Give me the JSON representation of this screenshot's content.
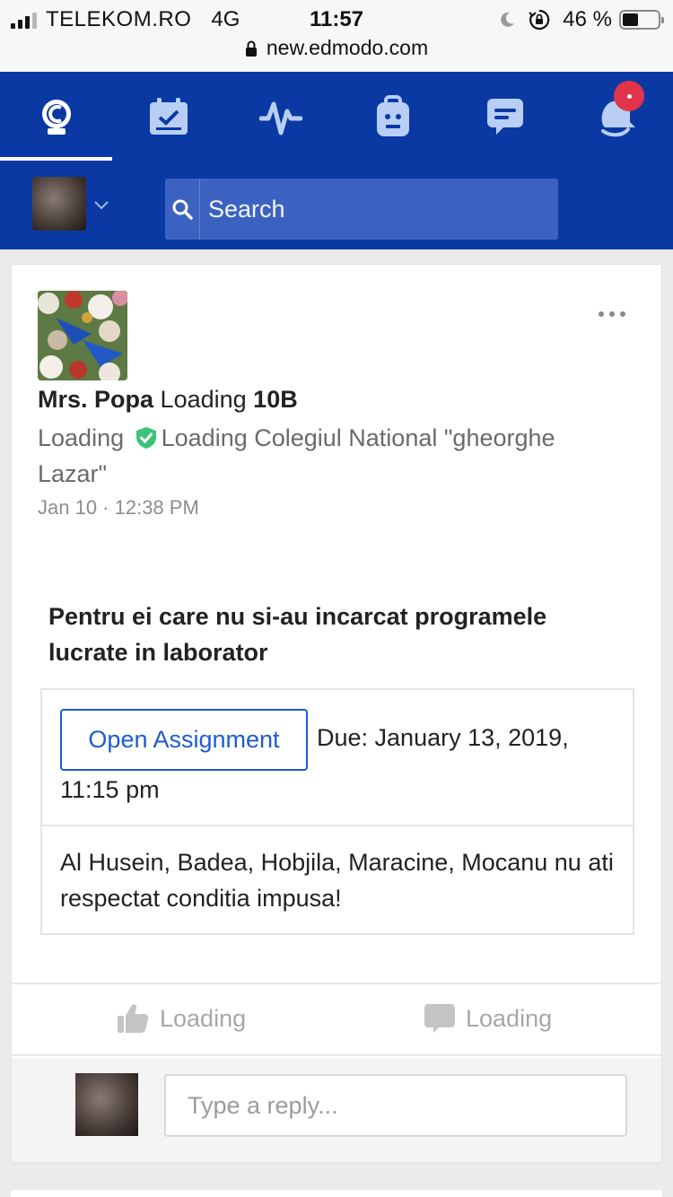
{
  "status_bar": {
    "carrier": "TELEKOM.RO",
    "network": "4G",
    "time": "11:57",
    "battery": "46 %",
    "battery_level": 0.46
  },
  "browser": {
    "url": "new.edmodo.com"
  },
  "nav": {
    "icons": [
      "home-icon",
      "planner-icon",
      "progress-icon",
      "backpack-icon",
      "messages-icon",
      "notifications-icon"
    ],
    "active_index": 0,
    "accent": "#0a39a3",
    "badge_color": "#e0344a"
  },
  "search": {
    "placeholder": "Search"
  },
  "post": {
    "author": "Mrs. Popa",
    "author_link_word": "Loading",
    "group": "10B",
    "school_prefix": "Loading",
    "school_text": "Loading Colegiul National \"gheorghe Lazar\"",
    "timestamp": "Jan 10 · 12:38 PM",
    "title": "Pentru ei care nu si-au incarcat programele lucrate in laborator",
    "assignment": {
      "button_label": "Open Assignment",
      "due_first": "Due: January 13, 2019,",
      "due_second": "11:15 pm",
      "message": "Al Husein, Badea, Hobjila, Maracine, Mocanu nu ati respectat conditia impusa!"
    },
    "actions": {
      "like_label": "Loading",
      "comment_label": "Loading"
    },
    "reply": {
      "placeholder": "Type a reply..."
    }
  }
}
